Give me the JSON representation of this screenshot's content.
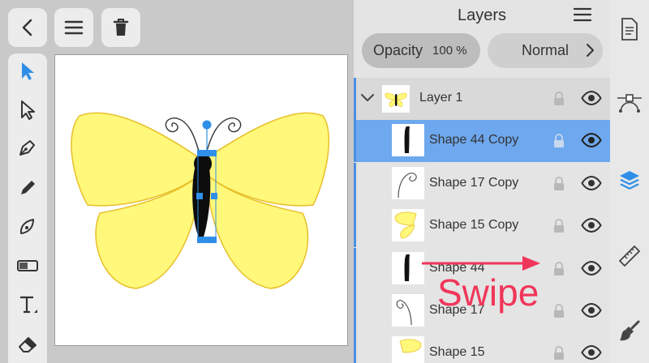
{
  "colors": {
    "accent": "#2f8fe8",
    "selection": "#6ea8ee",
    "wing_fill": "#fff87a",
    "wing_stroke": "#e8c02a",
    "annotation": "#f0365a"
  },
  "top_toolbar": {
    "icons": [
      "chevron-left-icon",
      "hamburger-menu-icon",
      "trash-icon"
    ]
  },
  "tools": [
    "select-arrow-icon",
    "node-arrow-icon",
    "pen-icon",
    "pencil-icon",
    "vector-brush-icon",
    "fill-icon",
    "text-icon",
    "eraser-icon"
  ],
  "layers_panel": {
    "title": "Layers",
    "opacity_label": "Opacity",
    "opacity_value": "100 %",
    "blend_mode": "Normal",
    "layer_group": {
      "name": "Layer 1",
      "expanded": true
    },
    "layers": [
      {
        "name": "Shape 44 Copy",
        "selected": true
      },
      {
        "name": "Shape 17 Copy",
        "selected": false
      },
      {
        "name": "Shape 15 Copy",
        "selected": false
      },
      {
        "name": "Shape 44",
        "selected": false
      },
      {
        "name": "Shape 17",
        "selected": false
      },
      {
        "name": "Shape 15",
        "selected": false
      }
    ]
  },
  "annotation": {
    "text": "Swipe"
  },
  "right_toolbar": {
    "icons": [
      "document-icon",
      "path-nodes-icon",
      "layers-icon",
      "ruler-icon",
      "brush-icon"
    ],
    "active": "layers-icon"
  }
}
